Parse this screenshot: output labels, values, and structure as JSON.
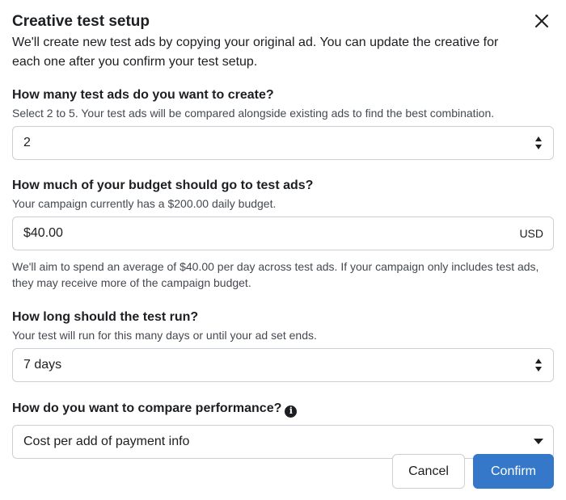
{
  "dialog": {
    "title": "Creative test setup",
    "intro": "We'll create new test ads by copying your original ad. You can update the creative for each one after you confirm your test setup."
  },
  "test_ads": {
    "label": "How many test ads do you want to create?",
    "helper": "Select 2 to 5. Your test ads will be compared alongside existing ads to find the best combination.",
    "value": "2"
  },
  "budget": {
    "label": "How much of your budget should go to test ads?",
    "helper": "Your campaign currently has a $200.00 daily budget.",
    "value": "$40.00",
    "currency": "USD",
    "note": "We'll aim to spend an average of $40.00 per day across test ads. If your campaign only includes test ads, they may receive more of the campaign budget."
  },
  "duration": {
    "label": "How long should the test run?",
    "helper": "Your test will run for this many days or until your ad set ends.",
    "value": "7 days"
  },
  "compare": {
    "label": "How do you want to compare performance?",
    "info_icon_glyph": "i",
    "value": "Cost per add of payment info"
  },
  "footer": {
    "cancel_label": "Cancel",
    "confirm_label": "Confirm"
  },
  "colors": {
    "primary": "#3578c9",
    "text": "#1c1e21",
    "secondary_text": "#444950",
    "border": "#ccd0d5"
  }
}
